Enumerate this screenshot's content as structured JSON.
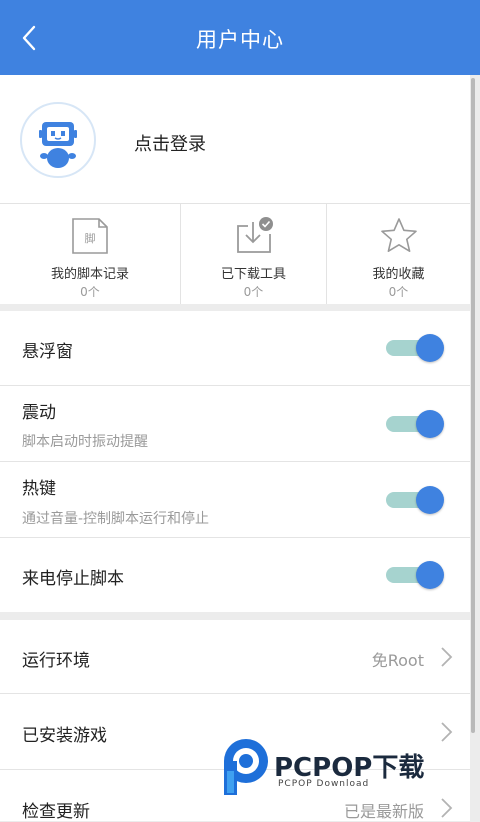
{
  "header": {
    "title": "用户中心",
    "back_icon": "chevron-left-icon"
  },
  "profile": {
    "login_text": "点击登录",
    "avatar_icon": "robot-avatar-icon"
  },
  "stats": [
    {
      "label": "我的脚本记录",
      "count": "0个",
      "icon": "script-file-icon",
      "icon_char": "脚"
    },
    {
      "label": "已下载工具",
      "count": "0个",
      "icon": "download-tray-icon"
    },
    {
      "label": "我的收藏",
      "count": "0个",
      "icon": "star-icon"
    }
  ],
  "toggles": [
    {
      "name": "悬浮窗",
      "desc": "",
      "on": true
    },
    {
      "name": "震动",
      "desc": "脚本启动时振动提醒",
      "on": true
    },
    {
      "name": "热键",
      "desc": "通过音量-控制脚本运行和停止",
      "on": true
    },
    {
      "name": "来电停止脚本",
      "desc": "",
      "on": true
    }
  ],
  "settings": [
    {
      "name": "运行环境",
      "value": "免Root"
    },
    {
      "name": "已安装游戏",
      "value": ""
    },
    {
      "name": "检查更新",
      "value": "已是最新版"
    }
  ],
  "watermark": {
    "text": "PCPOP下载",
    "sub": "PCPOP Download"
  },
  "colors": {
    "primary": "#3f82e0",
    "toggle_track": "#a6d3cf",
    "background": "#ececec"
  }
}
